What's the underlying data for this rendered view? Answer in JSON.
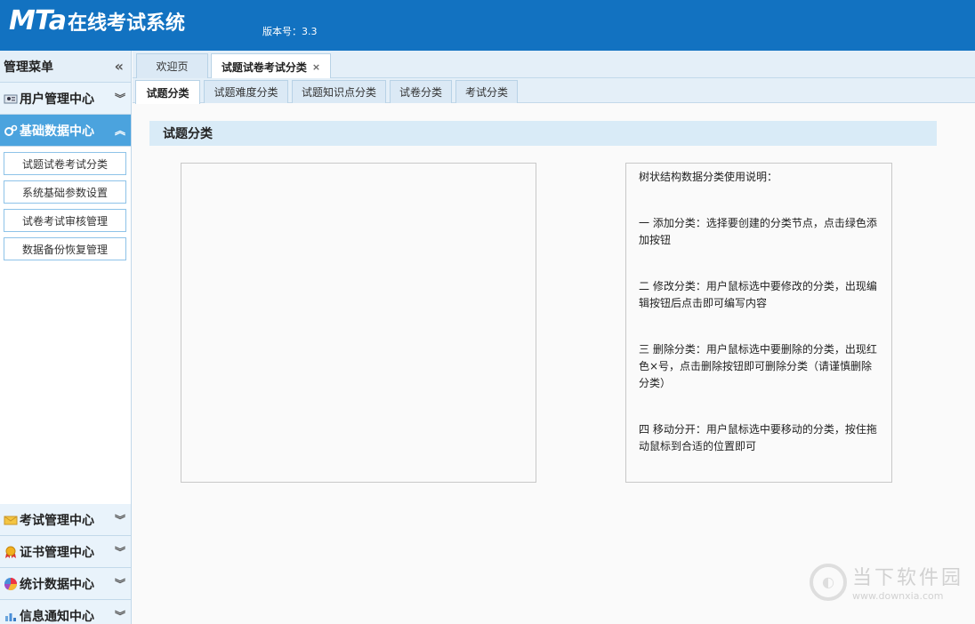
{
  "header": {
    "brand": "MTa",
    "title": "在线考试系统",
    "version": "版本号：3.3"
  },
  "sidebar": {
    "title": "管理菜单",
    "groups": [
      {
        "label": "用户管理中心",
        "icon": "user-icon"
      },
      {
        "label": "基础数据中心",
        "icon": "gears-icon",
        "active": true
      }
    ],
    "sub_items": [
      "试题试卷考试分类",
      "系统基础参数设置",
      "试卷考试审核管理",
      "数据备份恢复管理"
    ],
    "bottom_groups": [
      {
        "label": "考试管理中心",
        "icon": "envelope-icon"
      },
      {
        "label": "证书管理中心",
        "icon": "medal-icon"
      },
      {
        "label": "统计数据中心",
        "icon": "pie-chart-icon"
      },
      {
        "label": "信息通知中心",
        "icon": "bar-chart-icon"
      }
    ]
  },
  "tabs": [
    {
      "label": "欢迎页"
    },
    {
      "label": "试题试卷考试分类",
      "active": true,
      "close": "×"
    }
  ],
  "subtabs": [
    {
      "label": "试题分类",
      "active": true
    },
    {
      "label": "试题难度分类"
    },
    {
      "label": "试题知识点分类"
    },
    {
      "label": "试卷分类"
    },
    {
      "label": "考试分类"
    }
  ],
  "content": {
    "panel_title": "试题分类",
    "help": [
      "树状结构数据分类使用说明：",
      "一  添加分类：选择要创建的分类节点，点击绿色添加按钮",
      "二  修改分类：用户鼠标选中要修改的分类，出现编辑按钮后点击即可编写内容",
      "三  删除分类：用户鼠标选中要删除的分类，出现红色×号，点击删除按钮即可删除分类（请谨慎删除分类）",
      "四  移动分开：用户鼠标选中要移动的分类，按住拖动鼠标到合适的位置即可"
    ]
  },
  "watermark": {
    "cn": "当下软件园",
    "url": "www.downxia.com"
  }
}
